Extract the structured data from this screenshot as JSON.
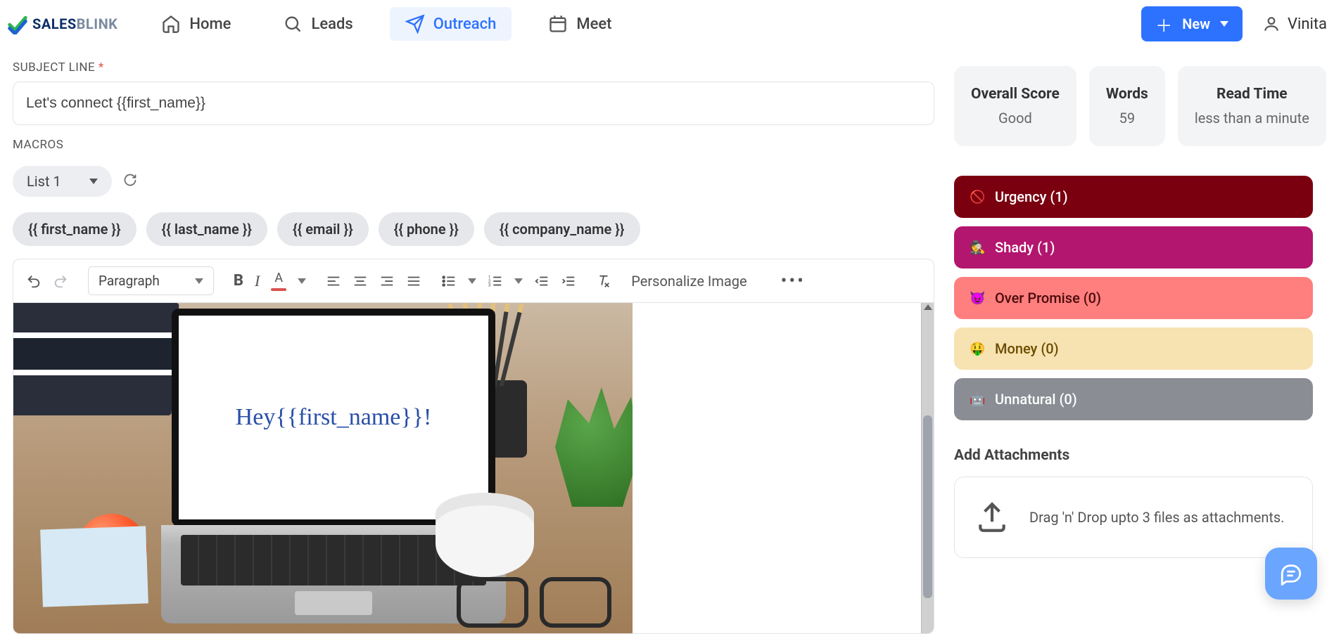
{
  "brand": {
    "part1": "SALES",
    "part2": "BLINK"
  },
  "nav": {
    "home": "Home",
    "leads": "Leads",
    "outreach": "Outreach",
    "meet": "Meet"
  },
  "new_btn": "New",
  "user_name": "Vinita",
  "subject": {
    "label": "SUBJECT LINE",
    "required_marker": "*",
    "value": "Let's connect {{first_name}}"
  },
  "macros": {
    "label": "MACROS",
    "list_selected": "List 1",
    "chips": [
      "{{ first_name }}",
      "{{ last_name }}",
      "{{ email }}",
      "{{ phone }}",
      "{{ company_name }}"
    ]
  },
  "toolbar": {
    "paragraph": "Paragraph",
    "personalize": "Personalize Image"
  },
  "editor_image_text": "Hey{{first_name}}!",
  "scores": {
    "overall": {
      "title": "Overall Score",
      "value": "Good"
    },
    "words": {
      "title": "Words",
      "value": "59"
    },
    "readtime": {
      "title": "Read Time",
      "value": "less than a minute"
    }
  },
  "alerts": {
    "urgency": {
      "icon": "🚫",
      "label": "Urgency (1)"
    },
    "shady": {
      "icon": "🕵️",
      "label": "Shady (1)"
    },
    "promise": {
      "icon": "😈",
      "label": "Over Promise (0)"
    },
    "money": {
      "icon": "🤑",
      "label": "Money (0)"
    },
    "unnatural": {
      "icon": "🤖",
      "label": "Unnatural (0)"
    }
  },
  "attachments": {
    "title": "Add Attachments",
    "hint": "Drag 'n' Drop upto 3 files as attachments."
  }
}
